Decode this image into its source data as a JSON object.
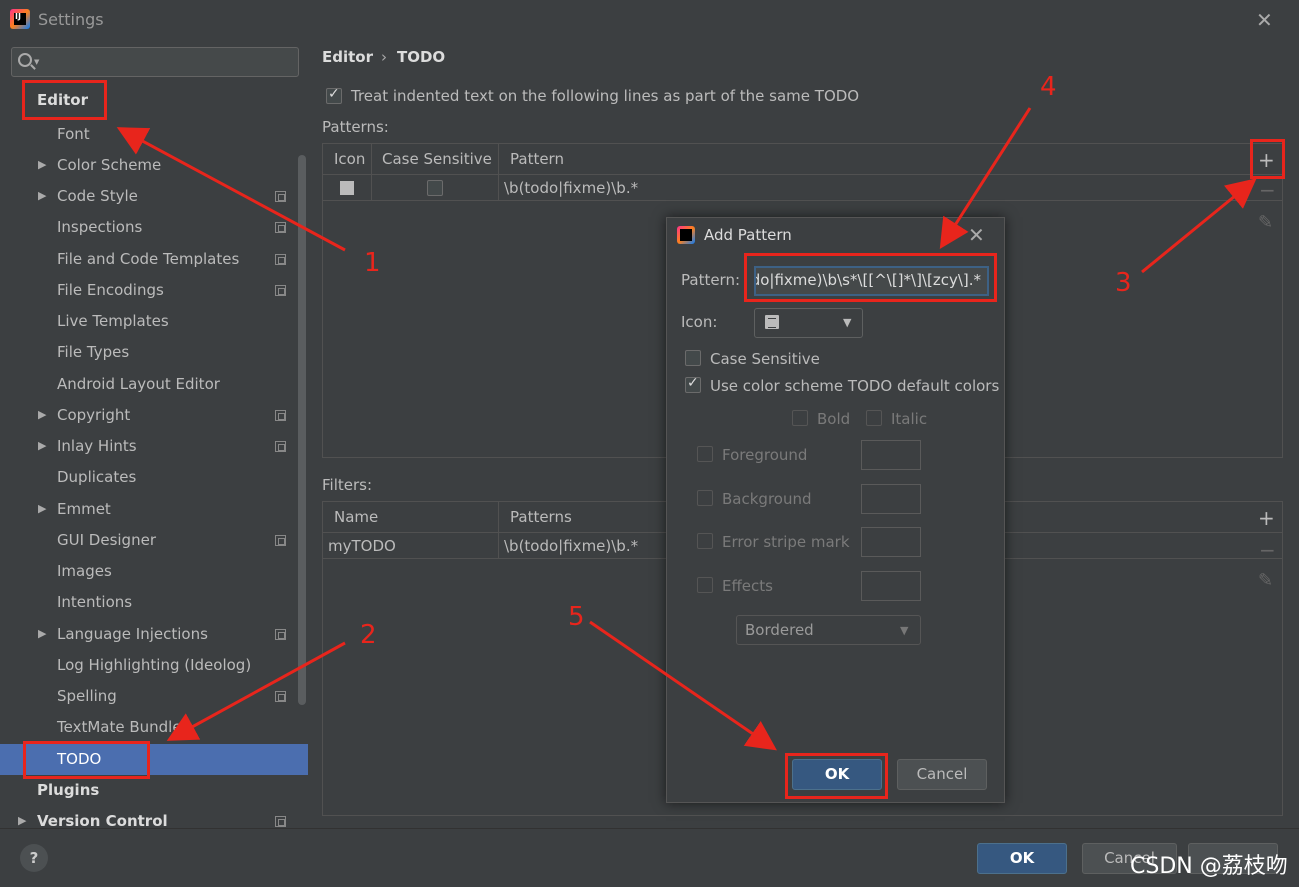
{
  "window": {
    "title": "Settings",
    "close": "✕"
  },
  "sidebar": {
    "search_placeholder": "",
    "items": [
      {
        "label": "Editor"
      },
      {
        "label": "Font"
      },
      {
        "label": "Color Scheme"
      },
      {
        "label": "Code Style"
      },
      {
        "label": "Inspections"
      },
      {
        "label": "File and Code Templates"
      },
      {
        "label": "File Encodings"
      },
      {
        "label": "Live Templates"
      },
      {
        "label": "File Types"
      },
      {
        "label": "Android Layout Editor"
      },
      {
        "label": "Copyright"
      },
      {
        "label": "Inlay Hints"
      },
      {
        "label": "Duplicates"
      },
      {
        "label": "Emmet"
      },
      {
        "label": "GUI Designer"
      },
      {
        "label": "Images"
      },
      {
        "label": "Intentions"
      },
      {
        "label": "Language Injections"
      },
      {
        "label": "Log Highlighting (Ideolog)"
      },
      {
        "label": "Spelling"
      },
      {
        "label": "TextMate Bundles"
      },
      {
        "label": "TODO"
      },
      {
        "label": "Plugins"
      },
      {
        "label": "Version Control"
      }
    ]
  },
  "breadcrumb": {
    "parent": "Editor",
    "separator": "›",
    "current": "TODO"
  },
  "options": {
    "treat_indented": "Treat indented text on the following lines as part of the same TODO"
  },
  "patterns": {
    "label": "Patterns:",
    "columns": [
      "Icon",
      "Case Sensitive",
      "Pattern"
    ],
    "rows": [
      {
        "pattern": "\\b(todo|fixme)\\b.*"
      }
    ]
  },
  "filters": {
    "label": "Filters:",
    "columns": [
      "Name",
      "Patterns"
    ],
    "rows": [
      {
        "name": "myTODO",
        "patterns": "\\b(todo|fixme)\\b.*"
      }
    ]
  },
  "side_buttons": {
    "add": "+",
    "remove": "−",
    "edit": "✎"
  },
  "dialog": {
    "title": "Add Pattern",
    "close": "✕",
    "pattern_label": "Pattern:",
    "pattern_value": "do|fixme)\\b\\s*\\[[^\\[]*\\]\\[zcy\\].*",
    "icon_label": "Icon:",
    "case_sensitive": "Case Sensitive",
    "use_default_colors": "Use color scheme TODO default colors",
    "bold": "Bold",
    "italic": "Italic",
    "foreground": "Foreground",
    "background": "Background",
    "error_stripe": "Error stripe mark",
    "effects": "Effects",
    "effects_type": "Bordered",
    "ok": "OK",
    "cancel": "Cancel"
  },
  "footer": {
    "help": "?",
    "ok": "OK",
    "cancel": "Cancel"
  },
  "annotations": [
    "1",
    "2",
    "3",
    "4",
    "5"
  ],
  "watermark": "CSDN @荔枝吻",
  "colors": {
    "selection": "#4b6eaf",
    "primary_button": "#365880",
    "annotation": "#e8251c"
  }
}
